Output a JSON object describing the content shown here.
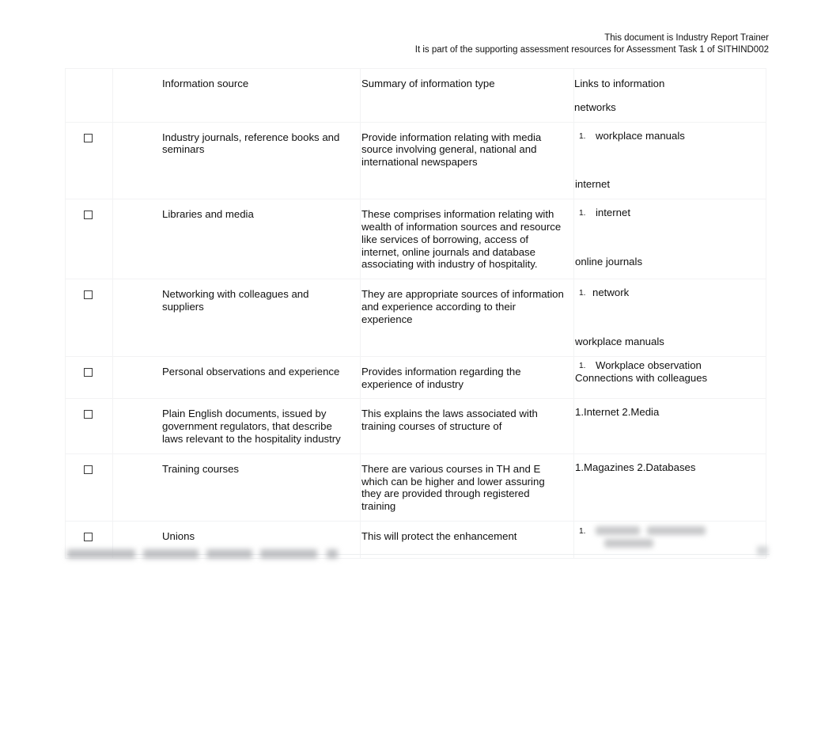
{
  "document": {
    "header_lines": [
      "This document is Industry Report Trainer",
      "It is part of the supporting assessment resources for Assessment Task 1 of SITHIND002"
    ]
  },
  "table": {
    "columns": {
      "checkbox": "",
      "source": "Information source",
      "summary": "Summary of information type",
      "links_line1": "Links to information",
      "links_line2": "networks"
    },
    "rows": [
      {
        "checkbox_state": "unchecked",
        "source": "Industry journals, reference books and seminars",
        "summary": "Provide information relating with media source involving general, national and international newspapers",
        "links_numbered": "workplace manuals",
        "links_number": "1.",
        "links_plain": "internet"
      },
      {
        "checkbox_state": "unchecked",
        "source": "Libraries and media",
        "summary": "These comprises information relating with wealth of information sources and resource like services of borrowing, access of internet, online journals and database associating with industry of hospitality.",
        "links_numbered": "internet",
        "links_number": "1.",
        "links_plain": "online journals"
      },
      {
        "checkbox_state": "unchecked",
        "source": "Networking with colleagues and suppliers",
        "summary": "They are appropriate sources of information and experience according to their experience",
        "links_numbered": "network",
        "links_number": "1.",
        "links_plain": "workplace manuals"
      },
      {
        "checkbox_state": "unchecked",
        "source": "Personal observations and experience",
        "summary": "Provides information regarding the experience of industry",
        "links_numbered": "Workplace observation",
        "links_number": "1.",
        "links_plain": "Connections with colleagues"
      },
      {
        "checkbox_state": "unchecked",
        "source": "Plain English documents, issued by government regulators, that describe laws relevant to the hospitality industry",
        "summary": "This explains the laws associated with training courses of structure of",
        "links_plain": "1.Internet 2.Media"
      },
      {
        "checkbox_state": "unchecked",
        "source": "Training courses",
        "summary": "There are various courses in TH and E which can be higher and lower assuring they are provided through registered training",
        "links_plain": "1.Magazines 2.Databases"
      },
      {
        "checkbox_state": "unchecked",
        "source": "Unions",
        "summary": "This will protect the enhancement",
        "links_number": "1.",
        "links_redacted": true
      }
    ]
  },
  "footer": {
    "text_redacted": true,
    "page_number_redacted": true
  },
  "colors": {
    "text": "#111111",
    "border": "#f2f3f4",
    "rule": "#eceef0",
    "background": "#ffffff"
  }
}
